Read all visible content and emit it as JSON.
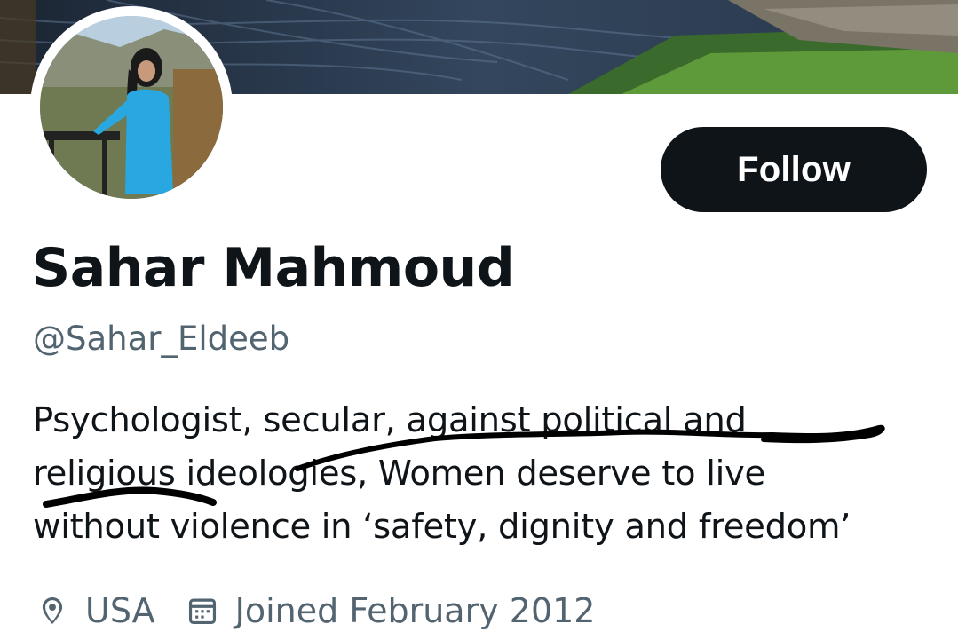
{
  "profile": {
    "display_name": "Sahar Mahmoud",
    "handle": "@Sahar_Eldeeb",
    "bio": "Psychologist, secular, against political and\nreligious ideologies, Women deserve to live\nwithout violence in ‘safety, dignity and freedom’",
    "location": "USA",
    "joined": "Joined February 2012"
  },
  "actions": {
    "follow_label": "Follow"
  },
  "icons": {
    "location": "location-pin-icon",
    "joined": "calendar-icon"
  },
  "colors": {
    "primary_text": "#0f1419",
    "secondary_text": "#536471",
    "button_bg": "#0f1419",
    "button_text": "#ffffff"
  }
}
